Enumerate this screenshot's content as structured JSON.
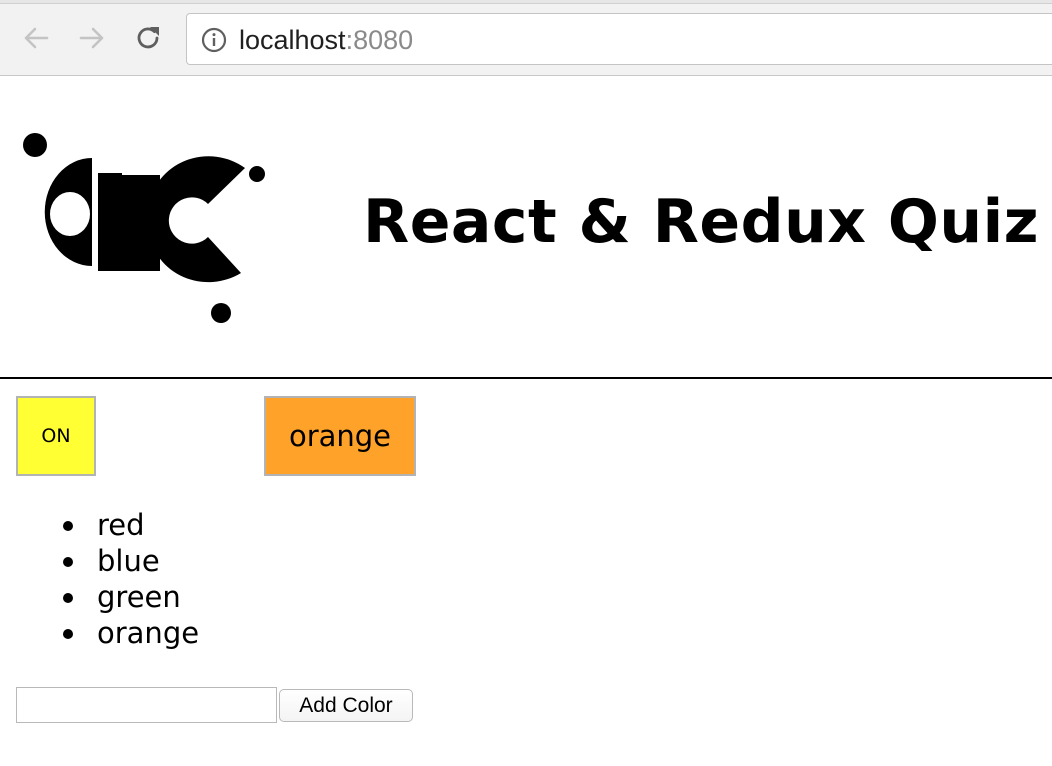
{
  "browser": {
    "url_host": "localhost",
    "url_port": ":8080",
    "icons": {
      "back": "arrow-left-icon",
      "forward": "arrow-right-icon",
      "reload": "reload-icon",
      "info": "info-icon"
    }
  },
  "header": {
    "logo_icon": "ac-logo",
    "title": "React & Redux Quiz"
  },
  "controls": {
    "toggle_label": "ON",
    "toggle_color": "#ffff33",
    "color_button_label": "orange",
    "color_button_bg": "#ffa229"
  },
  "colors": [
    "red",
    "blue",
    "green",
    "orange"
  ],
  "form": {
    "input_value": "",
    "add_button_label": "Add Color"
  }
}
